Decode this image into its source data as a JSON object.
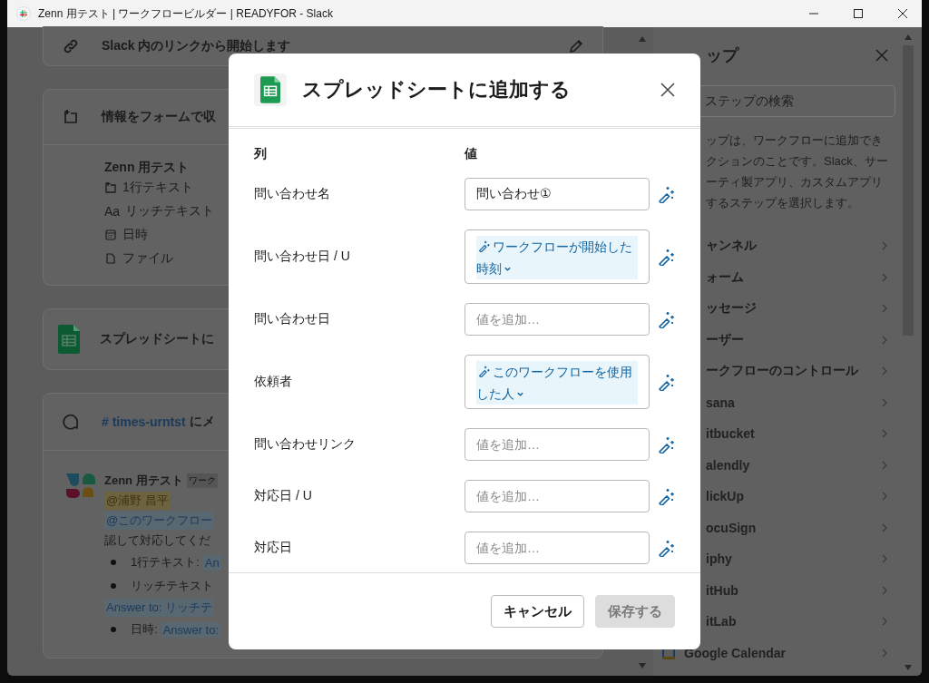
{
  "window": {
    "title": "Zenn 用テスト | ワークフロービルダー | READYFOR - Slack"
  },
  "workflow": {
    "steps": [
      {
        "kind": "link",
        "title": "Slack 内のリンクから開始します"
      },
      {
        "kind": "form",
        "title": "情報をフォームで収",
        "form": {
          "name": "Zenn 用テスト",
          "fields": [
            {
              "kind": "short_text",
              "label": "1行テキスト"
            },
            {
              "kind": "rich_text",
              "icon_text": "Aa",
              "label": "リッチテキスト"
            },
            {
              "kind": "datetime",
              "label": "日時"
            },
            {
              "kind": "file",
              "label": "ファイル"
            }
          ]
        }
      },
      {
        "kind": "sheet",
        "title": "スプレッドシートに"
      },
      {
        "kind": "message",
        "channel": "# times-urntst",
        "title": "にメ",
        "message": {
          "sender": "Zenn 用テスト",
          "tag": "ワーク",
          "mention": "@浦野 昌平",
          "lines": [
            {
              "kind": "chip",
              "text": "@このワークフロー"
            },
            {
              "kind": "plain",
              "text": "認して対応してくだ"
            },
            {
              "kind": "bullet",
              "text": "1行テキスト: ",
              "chip": "An"
            },
            {
              "kind": "bullet",
              "text": "リッチテキスト"
            },
            {
              "kind": "chip",
              "text": "Answer to: リッチテ"
            },
            {
              "kind": "bullet",
              "text": "日時: ",
              "chip": "Answer to:"
            }
          ]
        }
      }
    ]
  },
  "steps_panel": {
    "title": "ップ",
    "search": {
      "placeholder": "ステップの検索"
    },
    "description_lines": [
      "ップは、ワークフローに追加でき",
      "クションのことです。Slack、サー",
      "ーティ製アプリ、カスタムアプリ",
      "するステップを選択します。"
    ],
    "categories": [
      {
        "kind": "group",
        "label": "ャンネル"
      },
      {
        "kind": "group",
        "label": "ォーム"
      },
      {
        "kind": "group",
        "label": "ッセージ"
      },
      {
        "kind": "group",
        "label": "ーザー"
      },
      {
        "kind": "group",
        "label": "ークフローのコントロール"
      },
      {
        "kind": "app",
        "label": "sana"
      },
      {
        "kind": "app",
        "label": "itbucket"
      },
      {
        "kind": "app",
        "label": "alendly"
      },
      {
        "kind": "app",
        "label": "lickUp"
      },
      {
        "kind": "app",
        "label": "ocuSign"
      },
      {
        "kind": "app",
        "label": "iphy"
      },
      {
        "kind": "app",
        "label": "itHub"
      },
      {
        "kind": "app",
        "label": "itLab"
      },
      {
        "kind": "calendar_app",
        "label": "Google Calendar"
      }
    ]
  },
  "dialog": {
    "title": "スプレッドシートに追加する",
    "column_headers": [
      "列",
      "値"
    ],
    "rows": [
      {
        "label": "問い合わせ名",
        "kind": "text",
        "value": "問い合わせ①"
      },
      {
        "label": "問い合わせ日 / U",
        "kind": "variable",
        "value": "ワークフローが開始した時刻"
      },
      {
        "label": "問い合わせ日",
        "kind": "empty",
        "placeholder": "値を追加…"
      },
      {
        "label": "依頼者",
        "kind": "variable",
        "value": "このワークフローを使用した人"
      },
      {
        "label": "問い合わせリンク",
        "kind": "empty",
        "placeholder": "値を追加…"
      },
      {
        "label": "対応日 / U",
        "kind": "empty",
        "placeholder": "値を追加…"
      },
      {
        "label": "対応日",
        "kind": "empty",
        "placeholder": "値を追加…"
      }
    ],
    "buttons": [
      {
        "kind": "cancel",
        "label": "キャンセル",
        "disabled": false
      },
      {
        "kind": "save",
        "label": "保存する",
        "disabled": true
      }
    ]
  }
}
